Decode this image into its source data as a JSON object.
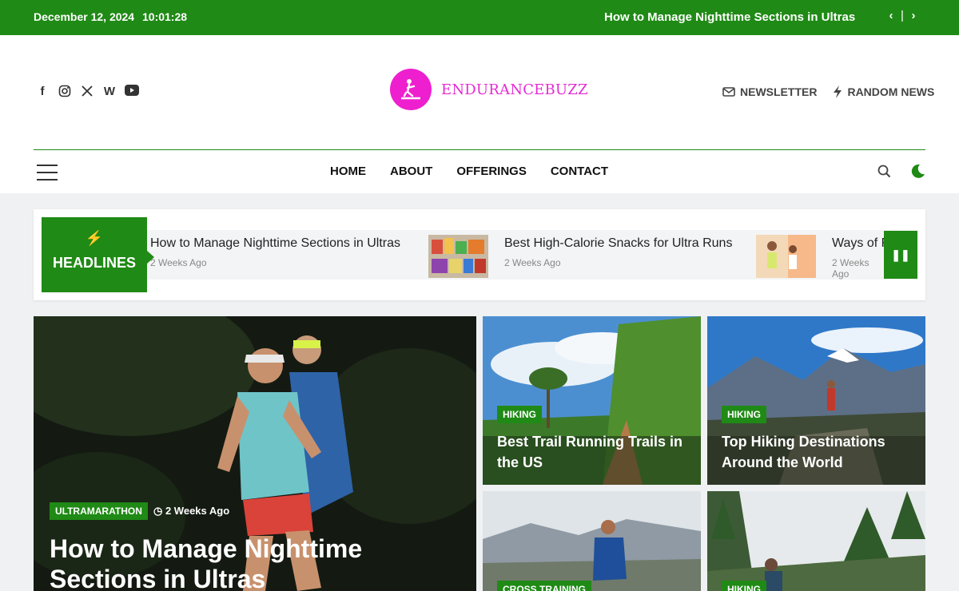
{
  "topbar": {
    "date": "December 12, 2024",
    "time": "10:01:28",
    "ticker_text": "How to Manage Nighttime Sections in Ultras"
  },
  "site": {
    "logo_text": "ENDURANCEBUZZ"
  },
  "header_links": {
    "newsletter": "NEWSLETTER",
    "random": "RANDOM NEWS"
  },
  "menu": [
    "HOME",
    "ABOUT",
    "OFFERINGS",
    "CONTACT"
  ],
  "headlines": {
    "label": "HEADLINES",
    "items": [
      {
        "title": "How to Manage Nighttime Sections in Ultras",
        "meta": "2 Weeks Ago"
      },
      {
        "title": "Best High-Calorie Snacks for Ultra Runs",
        "meta": "2 Weeks Ago"
      },
      {
        "title": "Ways of F",
        "meta": "2 Weeks Ago"
      }
    ]
  },
  "hero": {
    "category": "ULTRAMARATHON",
    "meta": "2 Weeks Ago",
    "title": "How to Manage Nighttime Sections in Ultras"
  },
  "cards": [
    {
      "category": "HIKING",
      "title": "Best Trail Running Trails in the US"
    },
    {
      "category": "HIKING",
      "title": "Top Hiking Destinations Around the World"
    },
    {
      "category": "CROSS TRAINING",
      "title": ""
    },
    {
      "category": "HIKING",
      "title": ""
    }
  ],
  "colors": {
    "brand_green": "#1f8a15",
    "logo_pink": "#ee1fce"
  }
}
